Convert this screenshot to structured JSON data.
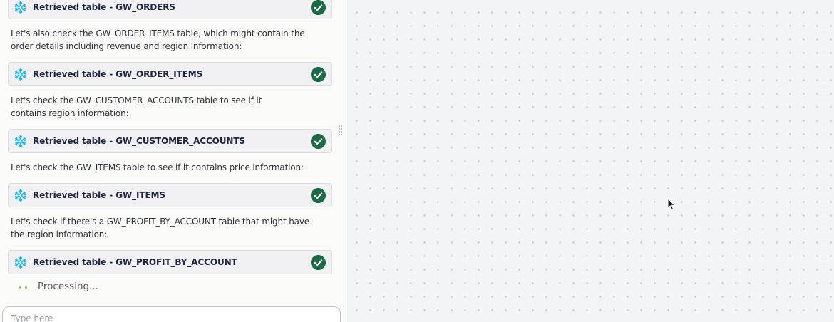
{
  "messages": {
    "card_1": "Retrieved table - GW_ORDERS",
    "text_1": "Let's also check the GW_ORDER_ITEMS table, which might contain the order details including revenue and region information:",
    "card_2": "Retrieved table - GW_ORDER_ITEMS",
    "text_2": "Let's check the GW_CUSTOMER_ACCOUNTS table to see if it contains region information:",
    "card_3": "Retrieved table - GW_CUSTOMER_ACCOUNTS",
    "text_3": "Let's check the GW_ITEMS table to see if it contains price information:",
    "card_4": "Retrieved table - GW_ITEMS",
    "text_4": "Let's check if there's a GW_PROFIT_BY_ACCOUNT table that might have the region information:",
    "card_5": "Retrieved table - GW_PROFIT_BY_ACCOUNT"
  },
  "status": {
    "processing": "Processing..."
  },
  "input": {
    "placeholder": "Type here"
  },
  "icons": {
    "tool_logo": "snowflake-icon",
    "status": "check-circle-icon",
    "splitter": "drag-handle-icon",
    "pointer": "mouse-cursor-icon"
  },
  "colors": {
    "snowflake": "#29b5e8",
    "check": "#1d6b46",
    "canvas_bg": "#f3f4f7",
    "canvas_dot": "#c9ccd4",
    "processing_dot": "#8bc34a"
  }
}
